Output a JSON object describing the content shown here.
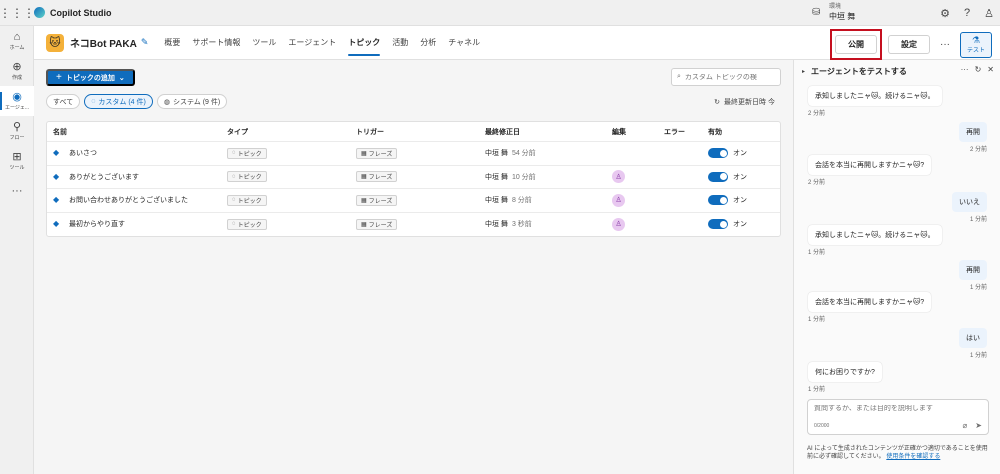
{
  "app": {
    "name": "Copilot Studio"
  },
  "environment": {
    "label": "環境",
    "name": "中垣 舞"
  },
  "bot": {
    "name": "ネコBot PAKA",
    "avatar": "🐱"
  },
  "nav": {
    "items": [
      {
        "label": "概要"
      },
      {
        "label": "サポート情報"
      },
      {
        "label": "ツール"
      },
      {
        "label": "エージェント"
      },
      {
        "label": "トピック"
      },
      {
        "label": "活動"
      },
      {
        "label": "分析"
      },
      {
        "label": "チャネル"
      }
    ],
    "active_index": 4
  },
  "actions": {
    "publish": "公開",
    "settings": "設定",
    "more": "···",
    "test": "テスト"
  },
  "rail": {
    "items": [
      {
        "label": "ホーム",
        "icon": "home-icon"
      },
      {
        "label": "作成",
        "icon": "plus-circle-icon"
      },
      {
        "label": "エージェ...",
        "icon": "agents-icon"
      },
      {
        "label": "フロー",
        "icon": "flow-icon"
      },
      {
        "label": "ツール",
        "icon": "tools-icon"
      }
    ]
  },
  "topics": {
    "add_button": "トピックの追加",
    "search_placeholder": "カスタム トピックの検",
    "filters": {
      "all": "すべて",
      "custom": "カスタム (4 件)",
      "system": "システム (9 件)"
    },
    "refresh": "最終更新日時 今",
    "columns": {
      "name": "名前",
      "type": "タイプ",
      "trigger": "トリガー",
      "modified": "最終修正日",
      "editing": "編集",
      "errors": "エラー",
      "enabled": "有効"
    },
    "rows": [
      {
        "name": "あいさつ",
        "type": "トピック",
        "trigger": "フレーズ",
        "modified_by": "中垣 舞",
        "modified_ago": "54 分前",
        "editing": false,
        "enabled": "オン"
      },
      {
        "name": "ありがとうございます",
        "type": "トピック",
        "trigger": "フレーズ",
        "modified_by": "中垣 舞",
        "modified_ago": "10 分前",
        "editing": true,
        "enabled": "オン"
      },
      {
        "name": "お問い合わせありがとうございました",
        "type": "トピック",
        "trigger": "フレーズ",
        "modified_by": "中垣 舞",
        "modified_ago": "8 分前",
        "editing": true,
        "enabled": "オン"
      },
      {
        "name": "最初からやり直す",
        "type": "トピック",
        "trigger": "フレーズ",
        "modified_by": "中垣 舞",
        "modified_ago": "3 秒前",
        "editing": true,
        "enabled": "オン"
      }
    ]
  },
  "test_panel": {
    "title": "エージェントをテストする",
    "messages": [
      {
        "from": "bot",
        "text": "承知しましたニャ🐱。続けるニャ🐱。",
        "time": "2 分前"
      },
      {
        "from": "user",
        "text": "再開",
        "time": "2 分前"
      },
      {
        "from": "bot",
        "text": "会話を本当に再開しますかニャ🐱?",
        "time": "2 分前"
      },
      {
        "from": "user",
        "text": "いいえ",
        "time": "1 分前"
      },
      {
        "from": "bot",
        "text": "承知しましたニャ🐱。続けるニャ🐱。",
        "time": "1 分前"
      },
      {
        "from": "user",
        "text": "再開",
        "time": "1 分前"
      },
      {
        "from": "bot",
        "text": "会話を本当に再開しますかニャ🐱?",
        "time": "1 分前"
      },
      {
        "from": "user",
        "text": "はい",
        "time": "1 分前"
      },
      {
        "from": "bot",
        "text": "何にお困りですか?",
        "time": "1 分前"
      }
    ],
    "composer_placeholder": "質問するか、または目的を説明します",
    "char_count": "0/2000",
    "disclaimer": "AI によって生成されたコンテンツが正確かつ適切であることを使用前に必ず確認してください。",
    "disclaimer_link": "使用条件を確認する"
  }
}
